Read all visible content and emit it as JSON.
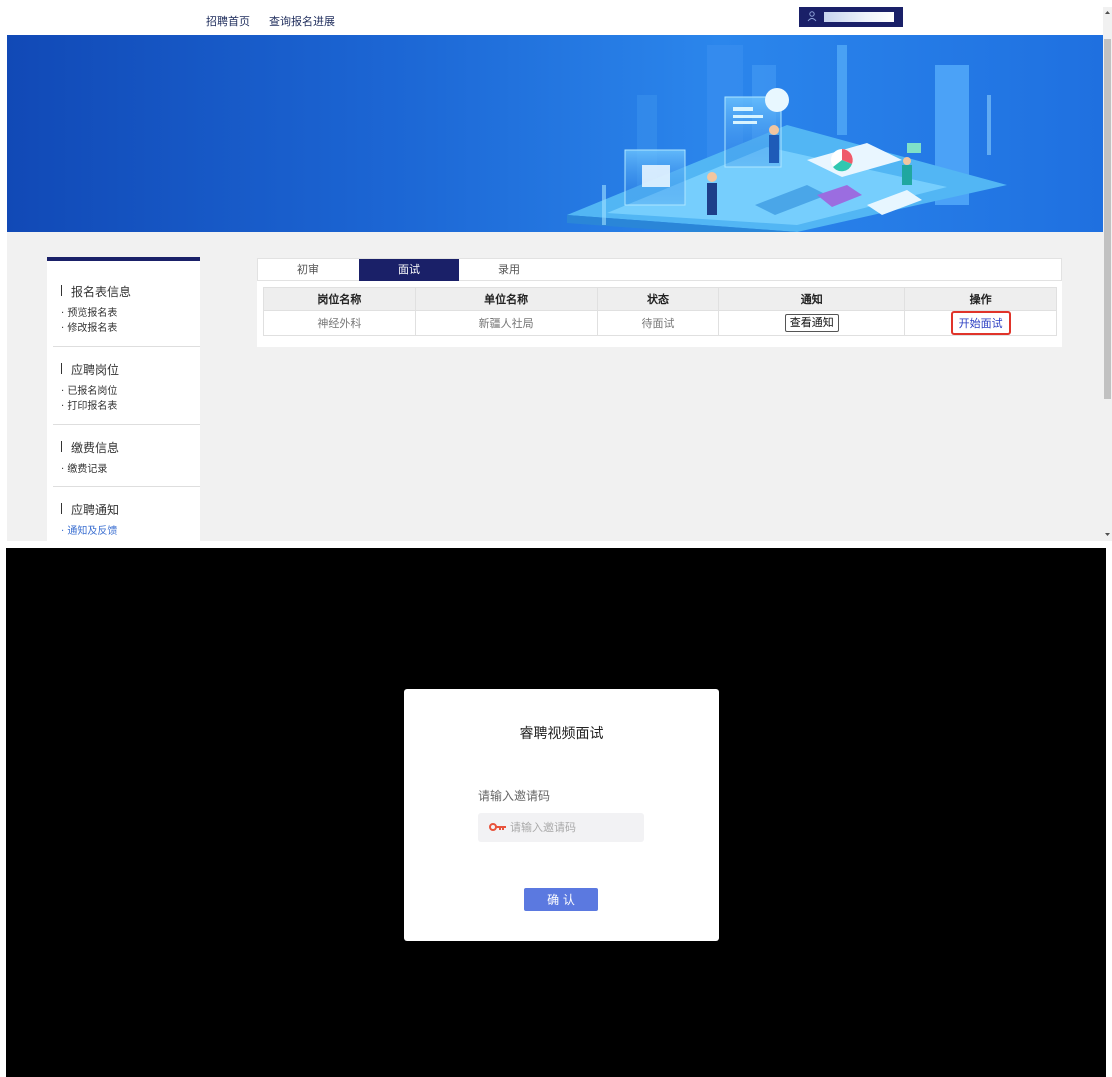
{
  "topnav": {
    "links": [
      "招聘首页",
      "查询报名进展"
    ]
  },
  "sidebar": {
    "groups": [
      {
        "title": "报名表信息",
        "items": [
          "预览报名表",
          "修改报名表"
        ]
      },
      {
        "title": "应聘岗位",
        "items": [
          "已报名岗位",
          "打印报名表"
        ]
      },
      {
        "title": "缴费信息",
        "items": [
          "缴费记录"
        ]
      },
      {
        "title": "应聘通知",
        "items": [
          "通知及反馈"
        ]
      }
    ],
    "active_item": "通知及反馈"
  },
  "tabs": [
    "初审",
    "面试",
    "录用"
  ],
  "active_tab": "面试",
  "table": {
    "headers": [
      "岗位名称",
      "单位名称",
      "状态",
      "通知",
      "操作"
    ],
    "rows": [
      {
        "position": "神经外科",
        "unit": "新疆人社局",
        "status": "待面试",
        "notice_button": "查看通知",
        "action": "开始面试"
      }
    ]
  },
  "modal": {
    "title": "睿聘视频面试",
    "label": "请输入邀请码",
    "input_placeholder": "请输入邀请码",
    "input_value": "",
    "confirm": "确 认"
  },
  "colors": {
    "nav_dark": "#1a2068",
    "banner_blue": "#1c66d4",
    "highlight_red": "#e0342a",
    "confirm_blue": "#5b79e0",
    "active_link": "#3b6fd1"
  },
  "icons": [
    "user-icon",
    "key-icon",
    "scroll-up-icon",
    "scroll-down-icon"
  ]
}
